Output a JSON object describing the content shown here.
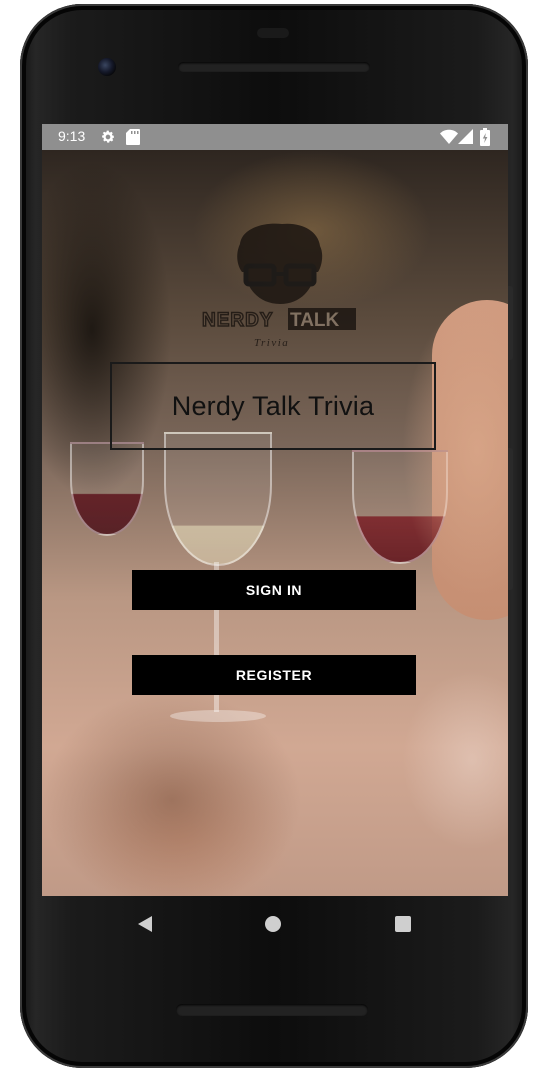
{
  "status_bar": {
    "time": "9:13",
    "icons": [
      "gear-icon",
      "sd-card-icon",
      "wifi-icon",
      "signal-icon",
      "battery-icon"
    ],
    "color": "#8f8f8f"
  },
  "logo": {
    "text_part1": "NERDY",
    "text_part2": "TALK",
    "subtitle": "Trivia",
    "icon": "nerd-face-logo"
  },
  "app": {
    "title": "Nerdy Talk Trivia"
  },
  "buttons": {
    "sign_in": "SIGN IN",
    "register": "REGISTER",
    "background": "#000000",
    "text_color": "#ffffff"
  },
  "nav_bar": {
    "icons": [
      "back-icon",
      "home-icon",
      "recents-icon"
    ]
  }
}
